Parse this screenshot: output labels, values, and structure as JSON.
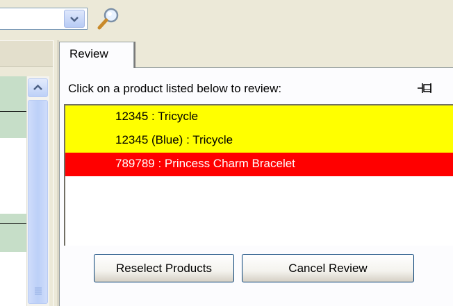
{
  "toolbar": {
    "combo_value": "",
    "combo_icon": "chevron-down-icon",
    "search_icon": "magnifier-icon"
  },
  "review": {
    "tab_label": "Review",
    "instruction": "Click on a product listed below to review:",
    "pin_icon": "pin-icon",
    "products": [
      {
        "label": "12345 : Tricycle",
        "status_color": "#ffff00"
      },
      {
        "label": "12345 (Blue) : Tricycle",
        "status_color": "#ffff00"
      },
      {
        "label": "789789 : Princess Charm Bracelet",
        "status_color": "#ff0000"
      }
    ],
    "buttons": {
      "reselect": "Reselect Products",
      "cancel": "Cancel Review"
    }
  }
}
